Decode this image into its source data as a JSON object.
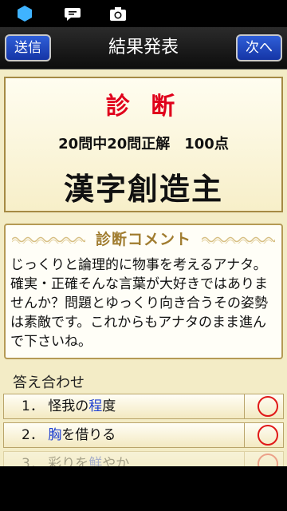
{
  "header": {
    "send_label": "送信",
    "title": "結果発表",
    "next_label": "次へ"
  },
  "result": {
    "heading": "診 断",
    "score": "20問中20問正解　100点",
    "rank": "漢字創造主"
  },
  "comment": {
    "title": "診断コメント",
    "text": "じっくりと論理的に物事を考えるアナタ。確実・正確そんな言葉が大好きではありませんか？問題とゆっくり向き合うその姿勢は素敵です。これからもアナタのまま進んで下さいね。"
  },
  "answers": {
    "label": "答え合わせ",
    "items": [
      {
        "num": "1．",
        "pre": "怪我の",
        "hl": "程",
        "post": "度",
        "result": "correct"
      },
      {
        "num": "2．",
        "pre": "",
        "hl": "胸",
        "post": "を借りる",
        "result": "correct"
      },
      {
        "num": "3．",
        "pre": "彩りを",
        "hl": "鮮",
        "post": "やか",
        "result": "correct"
      }
    ]
  },
  "colors": {
    "accent_red": "#e0001b",
    "button_blue": "#1535a6",
    "highlight_blue": "#1d3fd1",
    "panel_bg": "#f3ecc6"
  }
}
